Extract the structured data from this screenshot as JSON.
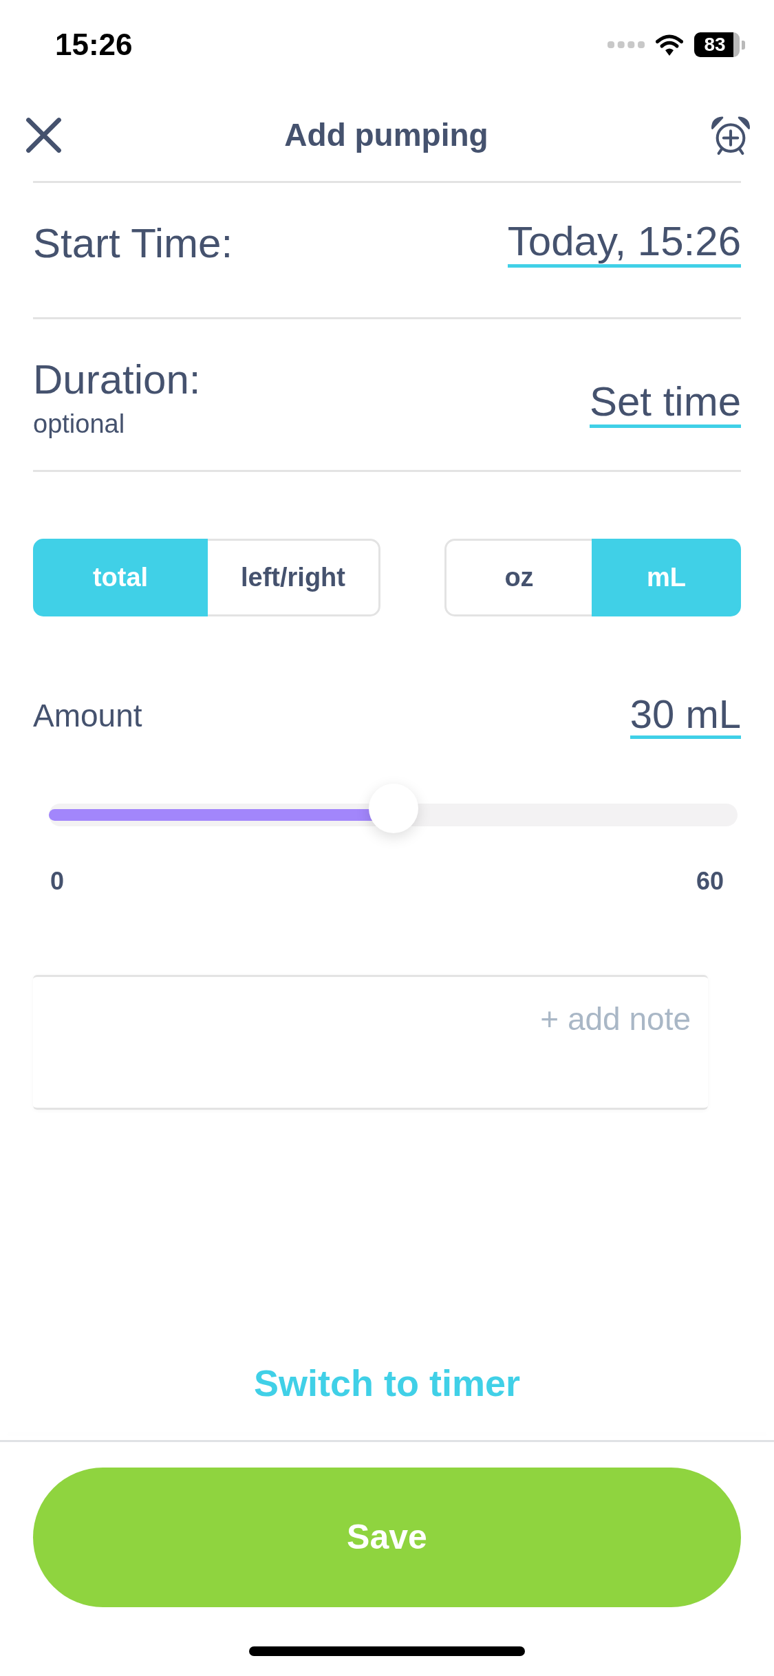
{
  "status_bar": {
    "time": "15:26",
    "battery": "83"
  },
  "header": {
    "title": "Add pumping"
  },
  "fields": [
    {
      "label": "Start Time:",
      "value": "Today, 15:26"
    },
    {
      "label": "Duration:",
      "sublabel": "optional",
      "value": "Set time"
    }
  ],
  "segmented_controls": [
    {
      "segments": [
        {
          "label": "total",
          "selected": true
        },
        {
          "label": "left/right",
          "selected": false
        }
      ]
    },
    {
      "segments": [
        {
          "label": "oz",
          "selected": false
        },
        {
          "label": "mL",
          "selected": true
        }
      ]
    }
  ],
  "amount": {
    "label": "Amount",
    "value": "30 mL",
    "level": 0.5,
    "min_label": "0",
    "max_label": "60"
  },
  "note": {
    "action": "+ add note"
  },
  "switch_link": "Switch to timer",
  "save_button": "Save"
}
